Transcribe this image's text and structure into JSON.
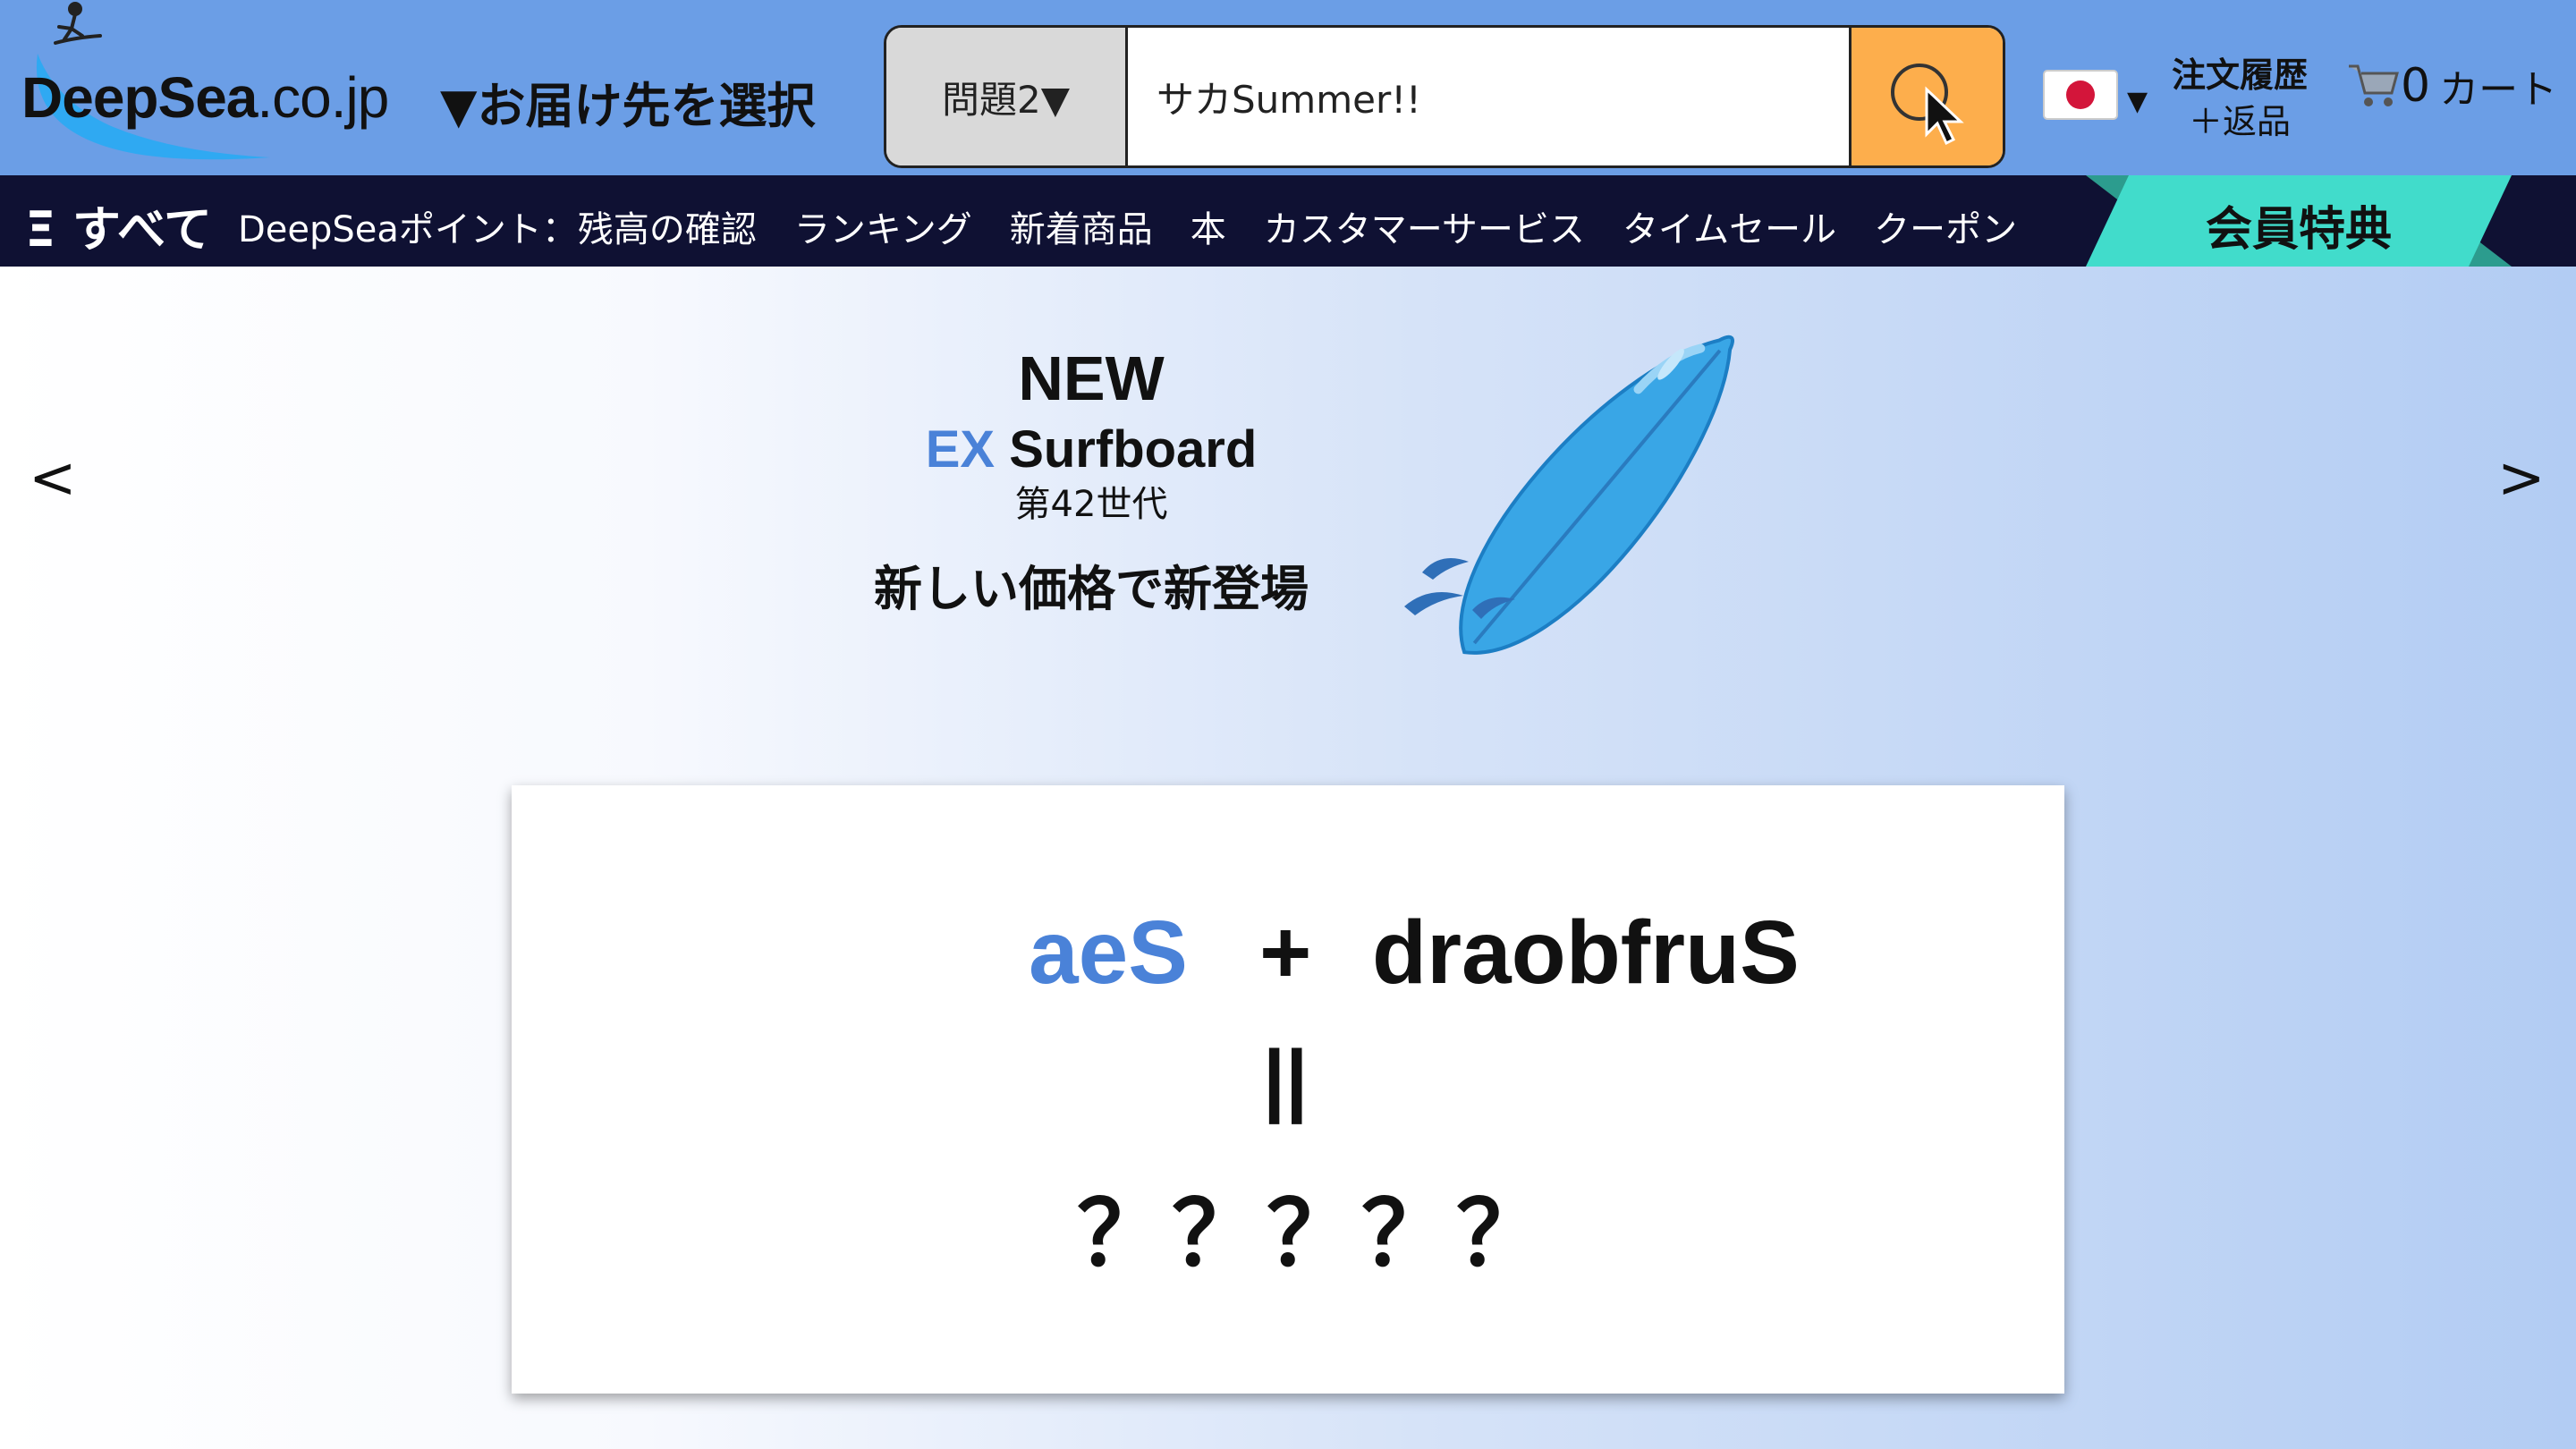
{
  "header": {
    "logo_main": "DeepSea",
    "logo_domain": ".co.jp",
    "deliver_label": "▼お届け先を選択",
    "search": {
      "category": "問題2▼",
      "value": "サカSummer!!"
    },
    "orders_line1": "注文履歴",
    "orders_line2": "＋返品",
    "cart_count": "0",
    "cart_label": "カート"
  },
  "nav": {
    "all_label": "Ξ すべて",
    "items": [
      "DeepSeaポイント：残高の確認",
      "ランキング",
      "新着商品",
      "本",
      "カスタマーサービス",
      "タイムセール",
      "クーポン"
    ],
    "member_label": "会員特典"
  },
  "hero": {
    "prev": "<",
    "next": ">",
    "promo": {
      "new_label": "NEW",
      "product_ex": "EX",
      "product_name": "Surfboard",
      "generation": "第42世代",
      "tagline": "新しい価格で新登場"
    },
    "puzzle": {
      "word1": "aeS",
      "plus": "+",
      "word2": "draobfruS",
      "equals": "||",
      "answer": "？？？？？"
    }
  },
  "colors": {
    "header_bg": "#6b9ee6",
    "nav_bg": "#0f1133",
    "search_button": "#fdae4c",
    "member_badge": "#41dccb",
    "accent_blue": "#4a82d8"
  },
  "icons": {
    "search": "search-icon",
    "cart": "cart-icon",
    "flag": "japan-flag-icon",
    "surfer": "surfer-logo-icon",
    "cursor": "mouse-cursor-icon"
  }
}
